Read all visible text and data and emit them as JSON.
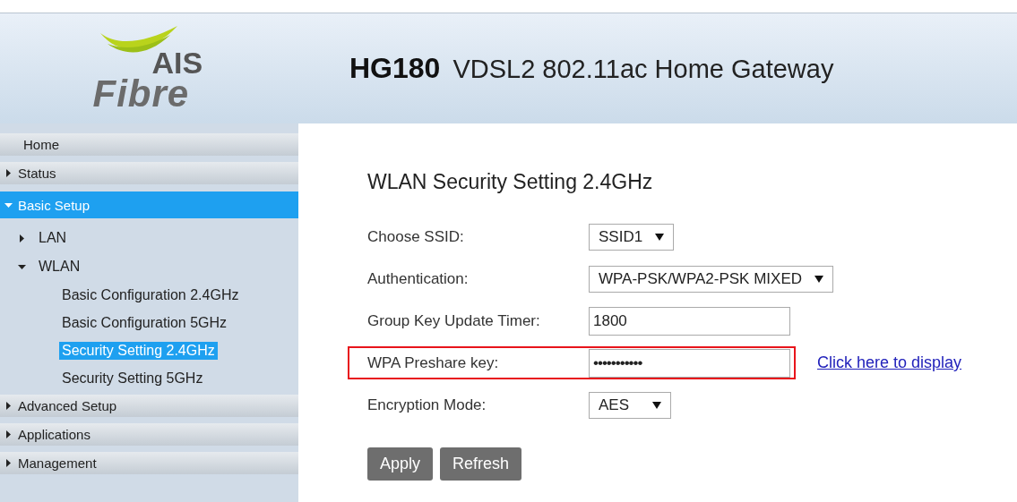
{
  "header": {
    "logo": {
      "brand": "AIS",
      "product": "Fibre"
    },
    "model": "HG180",
    "description": "VDSL2 802.11ac Home Gateway"
  },
  "sidebar": {
    "items": [
      {
        "label": "Home",
        "kind": "link",
        "selected": false
      },
      {
        "label": "Status",
        "kind": "group",
        "expanded": false,
        "selected": false
      },
      {
        "label": "Basic Setup",
        "kind": "group",
        "expanded": true,
        "selected": true,
        "children": [
          {
            "label": "LAN",
            "expanded": false
          },
          {
            "label": "WLAN",
            "expanded": true,
            "children": [
              {
                "label": "Basic Configuration 2.4GHz",
                "selected": false
              },
              {
                "label": "Basic Configuration 5GHz",
                "selected": false
              },
              {
                "label": "Security Setting 2.4GHz",
                "selected": true
              },
              {
                "label": "Security Setting 5GHz",
                "selected": false
              }
            ]
          }
        ]
      },
      {
        "label": "Advanced Setup",
        "kind": "group",
        "expanded": false,
        "selected": false
      },
      {
        "label": "Applications",
        "kind": "group",
        "expanded": false,
        "selected": false
      },
      {
        "label": "Management",
        "kind": "group",
        "expanded": false,
        "selected": false
      }
    ]
  },
  "form": {
    "title": "WLAN Security Setting 2.4GHz",
    "fields": [
      {
        "label": "Choose SSID:",
        "kind": "select",
        "value": "SSID1",
        "highlighted": false
      },
      {
        "label": "Authentication:",
        "kind": "select",
        "value": "WPA-PSK/WPA2-PSK MIXED",
        "highlighted": false
      },
      {
        "label": "Group Key Update Timer:",
        "kind": "text",
        "value": "1800",
        "highlighted": false
      },
      {
        "label": "WPA Preshare key:",
        "kind": "password",
        "value": "•••••••••••",
        "highlighted": true,
        "link": "Click here to display"
      },
      {
        "label": "Encryption Mode:",
        "kind": "select",
        "value": "AES",
        "highlighted": false
      }
    ],
    "buttons": [
      "Apply",
      "Refresh"
    ]
  }
}
